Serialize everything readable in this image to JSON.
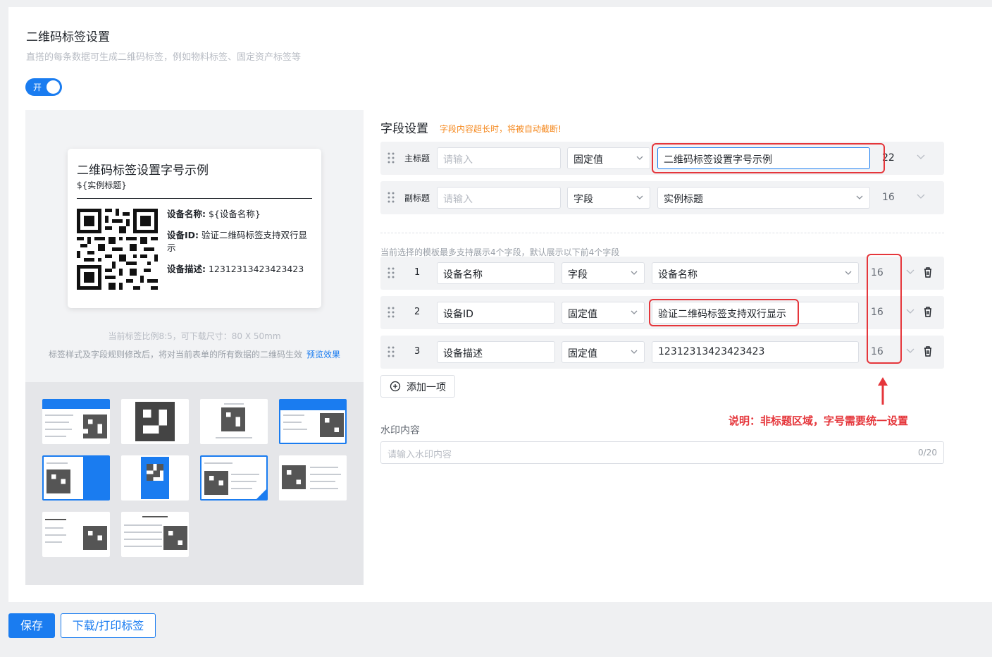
{
  "header": {
    "title": "二维码标签设置",
    "subtitle": "直搭的每条数据可生成二维码标签，例如物料标签、固定资产标签等"
  },
  "toggle": {
    "label": "开",
    "on": true
  },
  "preview": {
    "title": "二维码标签设置字号示例",
    "subtitle": "${实例标题}",
    "fields": [
      {
        "key": "设备名称:",
        "value": " ${设备名称}"
      },
      {
        "key": "设备ID:",
        "value": " 验证二维码标签支持双行显示"
      },
      {
        "key": "设备描述:",
        "value": " 12312313423423423"
      }
    ],
    "ratio_note": "当前标签比例8:5，可下载尺寸：80 X 50mm",
    "change_note": "标签样式及字段规则修改后，将对当前表单的所有数据的二维码生效",
    "preview_link": "预览效果"
  },
  "fields_section": {
    "title": "字段设置",
    "warning": "字段内容超长时，将被自动截断!",
    "main_title": {
      "label": "主标题",
      "placeholder": "请输入",
      "type": "固定值",
      "value": "二维码标签设置字号示例",
      "size": "22"
    },
    "sub_title": {
      "label": "副标题",
      "placeholder": "请输入",
      "type": "字段",
      "value": "实例标题",
      "size": "16"
    },
    "template_note": "当前选择的模板最多支持展示4个字段，默认展示以下前4个字段",
    "items": [
      {
        "num": "1",
        "name": "设备名称",
        "type": "字段",
        "value": "设备名称",
        "size": "16"
      },
      {
        "num": "2",
        "name": "设备ID",
        "type": "固定值",
        "value": "验证二维码标签支持双行显示",
        "size": "16"
      },
      {
        "num": "3",
        "name": "设备描述",
        "type": "固定值",
        "value": "12312313423423423",
        "size": "16"
      }
    ],
    "add_label": "添加一项",
    "annotation": "说明：非标题区域，字号需要统一设置"
  },
  "watermark": {
    "label": "水印内容",
    "placeholder": "请输入水印内容",
    "count": "0/20"
  },
  "footer": {
    "save_label": "保存",
    "download_label": "下载/打印标签"
  },
  "colors": {
    "accent": "#1a7cf0",
    "warning": "#f5891f",
    "annotation": "#e5363b"
  }
}
